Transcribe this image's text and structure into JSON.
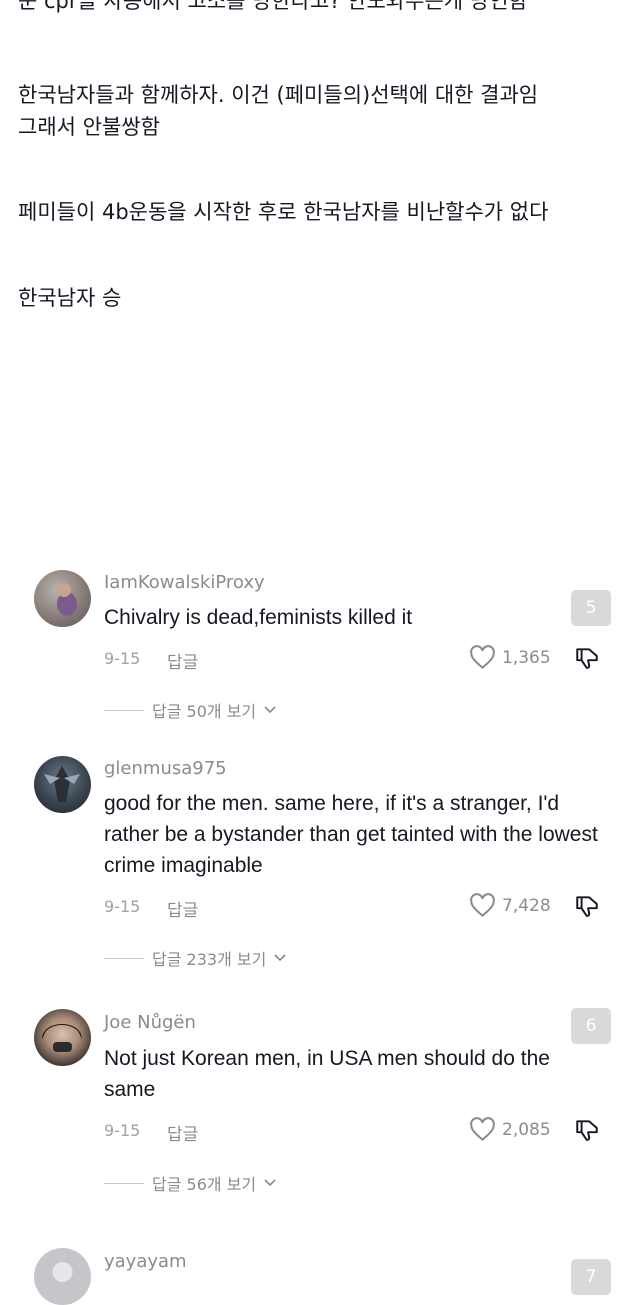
{
  "post": {
    "lines": [
      "운 cpr을 사용해서 고소를 당한다고? 안도와주는게 당연함",
      "한국남자들과 함께하자. 이건 (페미들의)선택에 대한 결과임",
      "그래서 안불쌍함",
      "페미들이 4b운동을 시작한 후로 한국남자를 비난할수가 없다",
      "한국남자 승"
    ]
  },
  "comments": [
    {
      "username": "IamKowalskiProxy",
      "text": "Chivalry is dead,feminists killed it",
      "date": "9-15",
      "reply_label": "답글",
      "likes": "1,365",
      "view_replies": "답글 50개 보기",
      "badge": "5"
    },
    {
      "username": "glenmusa975",
      "text": "good for the men. same here, if it's a stranger, I'd rather be a bystander than get tainted with the lowest crime imaginable",
      "date": "9-15",
      "reply_label": "답글",
      "likes": "7,428",
      "view_replies": "답글 233개 보기"
    },
    {
      "username": "Joe Nůgën",
      "text": "Not just Korean men, in USA men should do the same",
      "date": "9-15",
      "reply_label": "답글",
      "likes": "2,085",
      "view_replies": "답글 56개 보기",
      "badge": "6"
    },
    {
      "username": "yayayam",
      "badge": "7"
    }
  ],
  "colors": {
    "text": "#161823",
    "secondary": "#8a8b91",
    "badge_bg": "#d9d9db"
  }
}
